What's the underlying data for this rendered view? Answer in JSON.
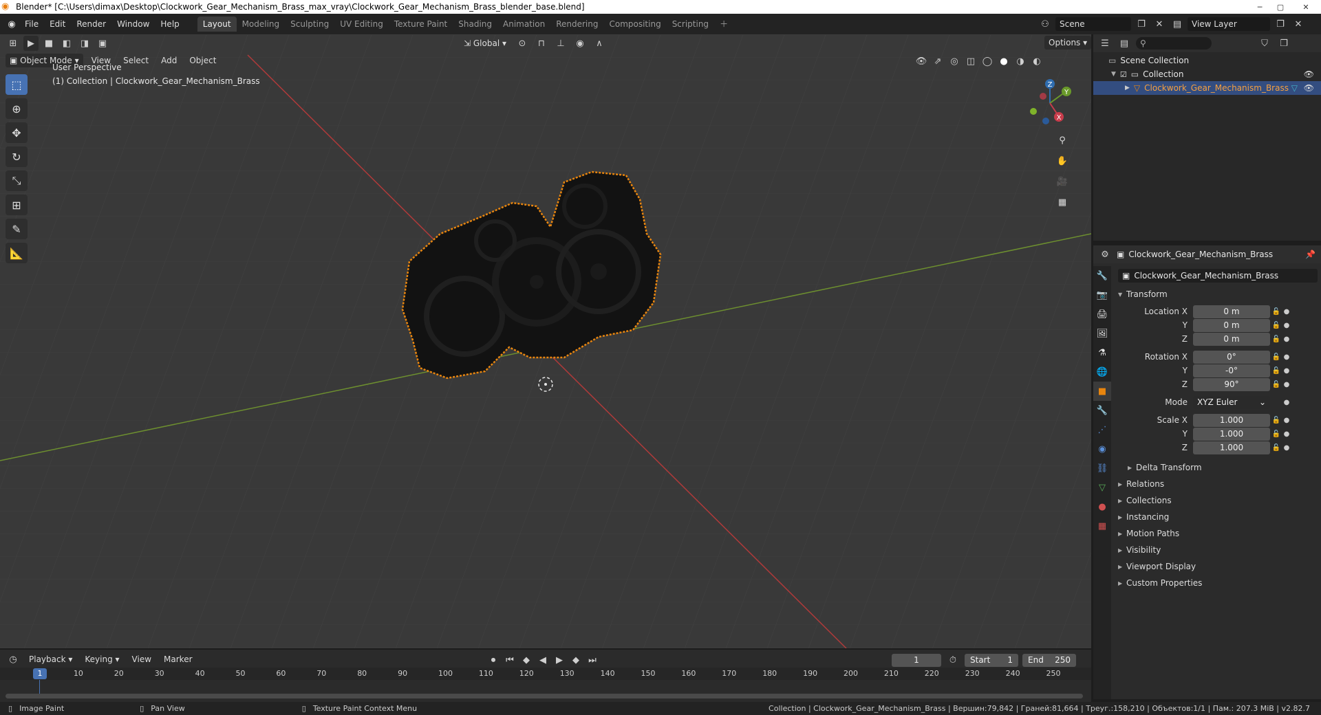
{
  "titlebar": {
    "title": "Blender* [C:\\Users\\dimax\\Desktop\\Clockwork_Gear_Mechanism_Brass_max_vray\\Clockwork_Gear_Mechanism_Brass_blender_base.blend]"
  },
  "menu": [
    "File",
    "Edit",
    "Render",
    "Window",
    "Help"
  ],
  "workspaces": [
    "Layout",
    "Modeling",
    "Sculpting",
    "UV Editing",
    "Texture Paint",
    "Shading",
    "Animation",
    "Rendering",
    "Compositing",
    "Scripting"
  ],
  "active_workspace": "Layout",
  "scene": {
    "label": "Scene",
    "view_layer": "View Layer"
  },
  "viewport": {
    "mode": "Object Mode",
    "menus": [
      "View",
      "Select",
      "Add",
      "Object"
    ],
    "orientation": "Global",
    "options": "Options",
    "info_line1": "User Perspective",
    "info_line2": "(1) Collection | Clockwork_Gear_Mechanism_Brass",
    "gizmo": {
      "x": "X",
      "y": "Y",
      "z": "Z"
    }
  },
  "outliner": {
    "scene_collection": "Scene Collection",
    "collection": "Collection",
    "object": "Clockwork_Gear_Mechanism_Brass"
  },
  "properties": {
    "header_object": "Clockwork_Gear_Mechanism_Brass",
    "object_name": "Clockwork_Gear_Mechanism_Brass",
    "transform_title": "Transform",
    "location": {
      "label": "Location X",
      "x": "0 m",
      "y": "0 m",
      "z": "0 m"
    },
    "rotation": {
      "label": "Rotation X",
      "x": "0°",
      "y": "-0°",
      "z": "90°"
    },
    "mode": {
      "label": "Mode",
      "value": "XYZ Euler"
    },
    "scale": {
      "label": "Scale X",
      "x": "1.000",
      "y": "1.000",
      "z": "1.000"
    },
    "axis_y": "Y",
    "axis_z": "Z",
    "delta": "Delta Transform",
    "panels": [
      "Relations",
      "Collections",
      "Instancing",
      "Motion Paths",
      "Visibility",
      "Viewport Display",
      "Custom Properties"
    ]
  },
  "timeline": {
    "menus": [
      "Playback",
      "Keying",
      "View",
      "Marker"
    ],
    "current_frame": "1",
    "start_label": "Start",
    "start": "1",
    "end_label": "End",
    "end": "250",
    "ticks": [
      "10",
      "20",
      "30",
      "40",
      "50",
      "60",
      "70",
      "80",
      "90",
      "100",
      "110",
      "120",
      "130",
      "140",
      "150",
      "160",
      "170",
      "180",
      "190",
      "200",
      "210",
      "220",
      "230",
      "240",
      "250"
    ],
    "playhead": "1"
  },
  "statusbar": {
    "left1": "Image Paint",
    "left2": "Pan View",
    "left3": "Texture Paint Context Menu",
    "right": "Collection | Clockwork_Gear_Mechanism_Brass | Вершин:79,842 | Граней:81,664 | Треуг.:158,210 | Объектов:1/1 | Пам.: 207.3 MiB | v2.82.7"
  },
  "colors": {
    "accent": "#4772b3",
    "selection": "#e8850e",
    "x_axis": "#b03a3a",
    "y_axis": "#6d8f2f"
  }
}
